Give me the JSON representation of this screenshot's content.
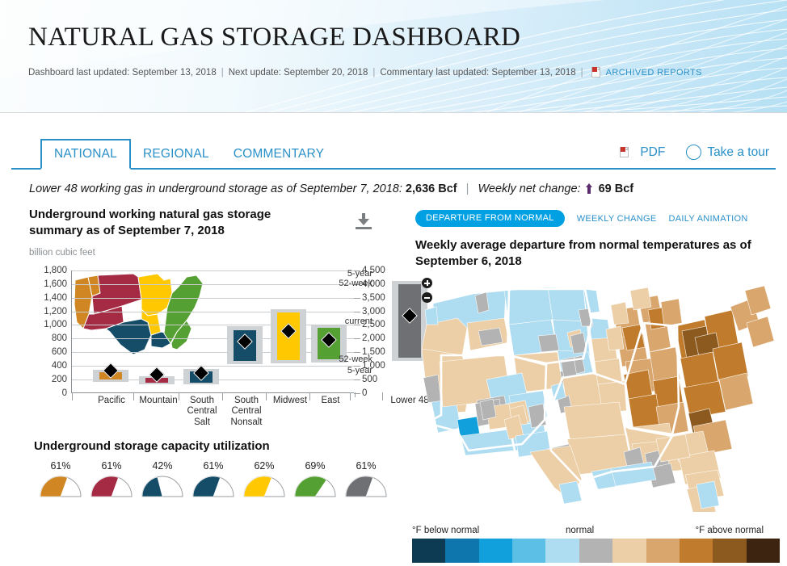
{
  "header": {
    "title": "NATURAL GAS STORAGE DASHBOARD",
    "meta": {
      "dashboard_updated": "Dashboard last updated: September 13, 2018",
      "next_update": "Next update: September 20, 2018",
      "commentary_updated": "Commentary last updated: September 13, 2018",
      "archived_link": "ARCHIVED REPORTS",
      "pdf_icon": "pdf-icon"
    }
  },
  "tabs": [
    {
      "label": "NATIONAL",
      "active": true
    },
    {
      "label": "REGIONAL",
      "active": false
    },
    {
      "label": "COMMENTARY",
      "active": false
    }
  ],
  "tab_actions": {
    "pdf_label": "PDF",
    "pdf_icon": "pdf-icon",
    "tour_label": "Take a tour",
    "tour_icon": "compass-icon"
  },
  "summary": {
    "lead": "Lower 48 working gas in underground storage as of September 7, 2018:",
    "value": "2,636 Bcf",
    "change_label": "Weekly net change:",
    "change_icon": "up-arrow-icon",
    "change_value": "69 Bcf",
    "change_color": "#5b2d6e"
  },
  "storage_panel": {
    "title": "Underground working natural gas storage summary as of September 7, 2018",
    "units": "billion cubic feet",
    "download_icon": "download-icon"
  },
  "chart_data": {
    "type": "bar",
    "title": "Underground working natural gas storage summary as of September 7, 2018",
    "ylabel": "billion cubic feet",
    "categories": [
      "Pacific",
      "Mountain",
      "South Central Salt",
      "South Central Nonsalt",
      "Midwest",
      "East",
      "Lower 48"
    ],
    "left_axis": {
      "ticks": [
        "0",
        "200",
        "400",
        "600",
        "800",
        "1,000",
        "1,200",
        "1,400",
        "1,600",
        "1,800"
      ],
      "min": 0,
      "max": 1800,
      "step": 200
    },
    "right_axis": {
      "ticks": [
        "0",
        "500",
        "1,000",
        "1,500",
        "2,000",
        "2,500",
        "3,000",
        "3,500",
        "4,000",
        "4,500"
      ],
      "min": 0,
      "max": 4500,
      "step": 500
    },
    "annotations": [
      "5-year",
      "52-week",
      "current",
      "52-week",
      "5-year"
    ],
    "series": [
      {
        "name": "Pacific",
        "color": "#d08723",
        "current": 245,
        "band_low": 196,
        "band_high": 305,
        "outer_low": 160,
        "outer_high": 345,
        "axis": "left"
      },
      {
        "name": "Mountain",
        "color": "#a52a44",
        "current": 186,
        "band_low": 152,
        "band_high": 228,
        "outer_low": 128,
        "outer_high": 252,
        "axis": "left"
      },
      {
        "name": "South Central Salt",
        "color": "#154d69",
        "current": 206,
        "band_low": 156,
        "band_high": 320,
        "outer_low": 130,
        "outer_high": 352,
        "axis": "left"
      },
      {
        "name": "South Central Nonsalt",
        "color": "#154d69",
        "current": 672,
        "band_low": 470,
        "band_high": 920,
        "outer_low": 420,
        "outer_high": 980,
        "axis": "left"
      },
      {
        "name": "Midwest",
        "color": "#ffc800",
        "current": 824,
        "band_low": 484,
        "band_high": 1180,
        "outer_low": 440,
        "outer_high": 1230,
        "axis": "left"
      },
      {
        "name": "East",
        "color": "#55a032",
        "current": 703,
        "band_low": 490,
        "band_high": 952,
        "outer_low": 450,
        "outer_high": 990,
        "axis": "left"
      },
      {
        "name": "Lower 48",
        "color": "#6e7073",
        "current": 2636,
        "band_low": 1310,
        "band_high": 3990,
        "outer_low": 1170,
        "outer_high": 4120,
        "axis": "right"
      }
    ]
  },
  "capacity": {
    "title": "Underground storage capacity utilization",
    "gauges": [
      {
        "label": "Pacific",
        "value": "61%",
        "pct": 61,
        "color": "#d08723"
      },
      {
        "label": "Mountain",
        "value": "61%",
        "pct": 61,
        "color": "#a52a44"
      },
      {
        "label": "South Central Salt",
        "value": "42%",
        "pct": 42,
        "color": "#154d69"
      },
      {
        "label": "South Central Nonsalt",
        "value": "61%",
        "pct": 61,
        "color": "#154d69"
      },
      {
        "label": "Midwest",
        "value": "62%",
        "pct": 62,
        "color": "#ffc800"
      },
      {
        "label": "East",
        "value": "69%",
        "pct": 69,
        "color": "#55a032"
      },
      {
        "label": "Lower 48",
        "value": "61%",
        "pct": 61,
        "color": "#6e7073"
      }
    ]
  },
  "map_panel": {
    "tabs": [
      {
        "label": "DEPARTURE FROM NORMAL",
        "active": true
      },
      {
        "label": "WEEKLY CHANGE",
        "active": false
      },
      {
        "label": "DAILY ANIMATION",
        "active": false
      }
    ],
    "active_color": "#00a0e2",
    "title": "Weekly average departure from normal temperatures as of September 6, 2018",
    "zoom_in_icon": "zoom-in-icon",
    "zoom_out_icon": "zoom-out-icon",
    "legend": {
      "left_label": "°F below normal",
      "center_label": "normal",
      "right_label": "°F above normal",
      "swatches": [
        "#0d3b54",
        "#0e76ac",
        "#12a0dc",
        "#5bbfe6",
        "#aedcf0",
        "#b3b3b3",
        "#eccfa6",
        "#d9a66d",
        "#c07c2c",
        "#8c5a1e",
        "#3c2410"
      ]
    }
  }
}
